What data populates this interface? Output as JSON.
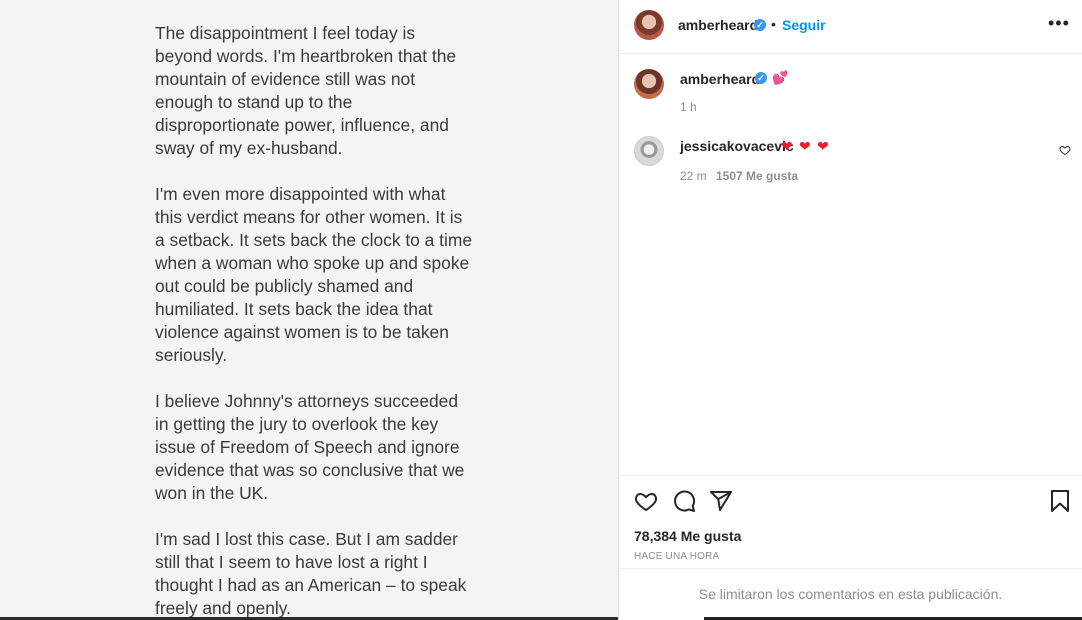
{
  "post_image": {
    "paragraphs": [
      "The disappointment I feel today is beyond words. I'm heartbroken that the mountain of evidence still was not enough to stand up to the disproportionate power, influence, and sway of my ex-husband.",
      "I'm even more disappointed with what this verdict means for other women. It is a setback. It sets back the clock to a time when a woman who spoke up and spoke out could be publicly shamed and humiliated. It sets back the idea that violence against women is to be taken seriously.",
      "I believe Johnny's attorneys succeeded in getting the jury to overlook the key issue of Freedom of Speech and ignore evidence that was so conclusive that we won in the UK.",
      "I'm sad I lost this case. But I am sadder still that I seem to have lost a right I thought I had as an American – to speak freely and openly."
    ]
  },
  "header": {
    "username": "amberheard",
    "separator": "•",
    "follow_label": "Seguir",
    "more_icon": "more-horizontal-icon"
  },
  "caption": {
    "username": "amberheard",
    "emoji": "💕",
    "time": "1 h"
  },
  "comments": [
    {
      "username": "jessicakovacevic",
      "hearts": [
        "❤",
        "❤",
        "❤"
      ],
      "time": "22 m",
      "likes": "1507 Me gusta"
    }
  ],
  "actions": {
    "like_icon": "heart-icon",
    "comment_icon": "comment-icon",
    "share_icon": "share-icon",
    "save_icon": "bookmark-icon"
  },
  "stats": {
    "likes": "78,384 Me gusta",
    "time_ago": "HACE UNA HORA"
  },
  "footer": {
    "limited_text": "Se limitaron los comentarios en esta publicación."
  },
  "colors": {
    "accent": "#0095f6",
    "verified": "#3897f0",
    "heart_red": "#ed1c2e"
  }
}
